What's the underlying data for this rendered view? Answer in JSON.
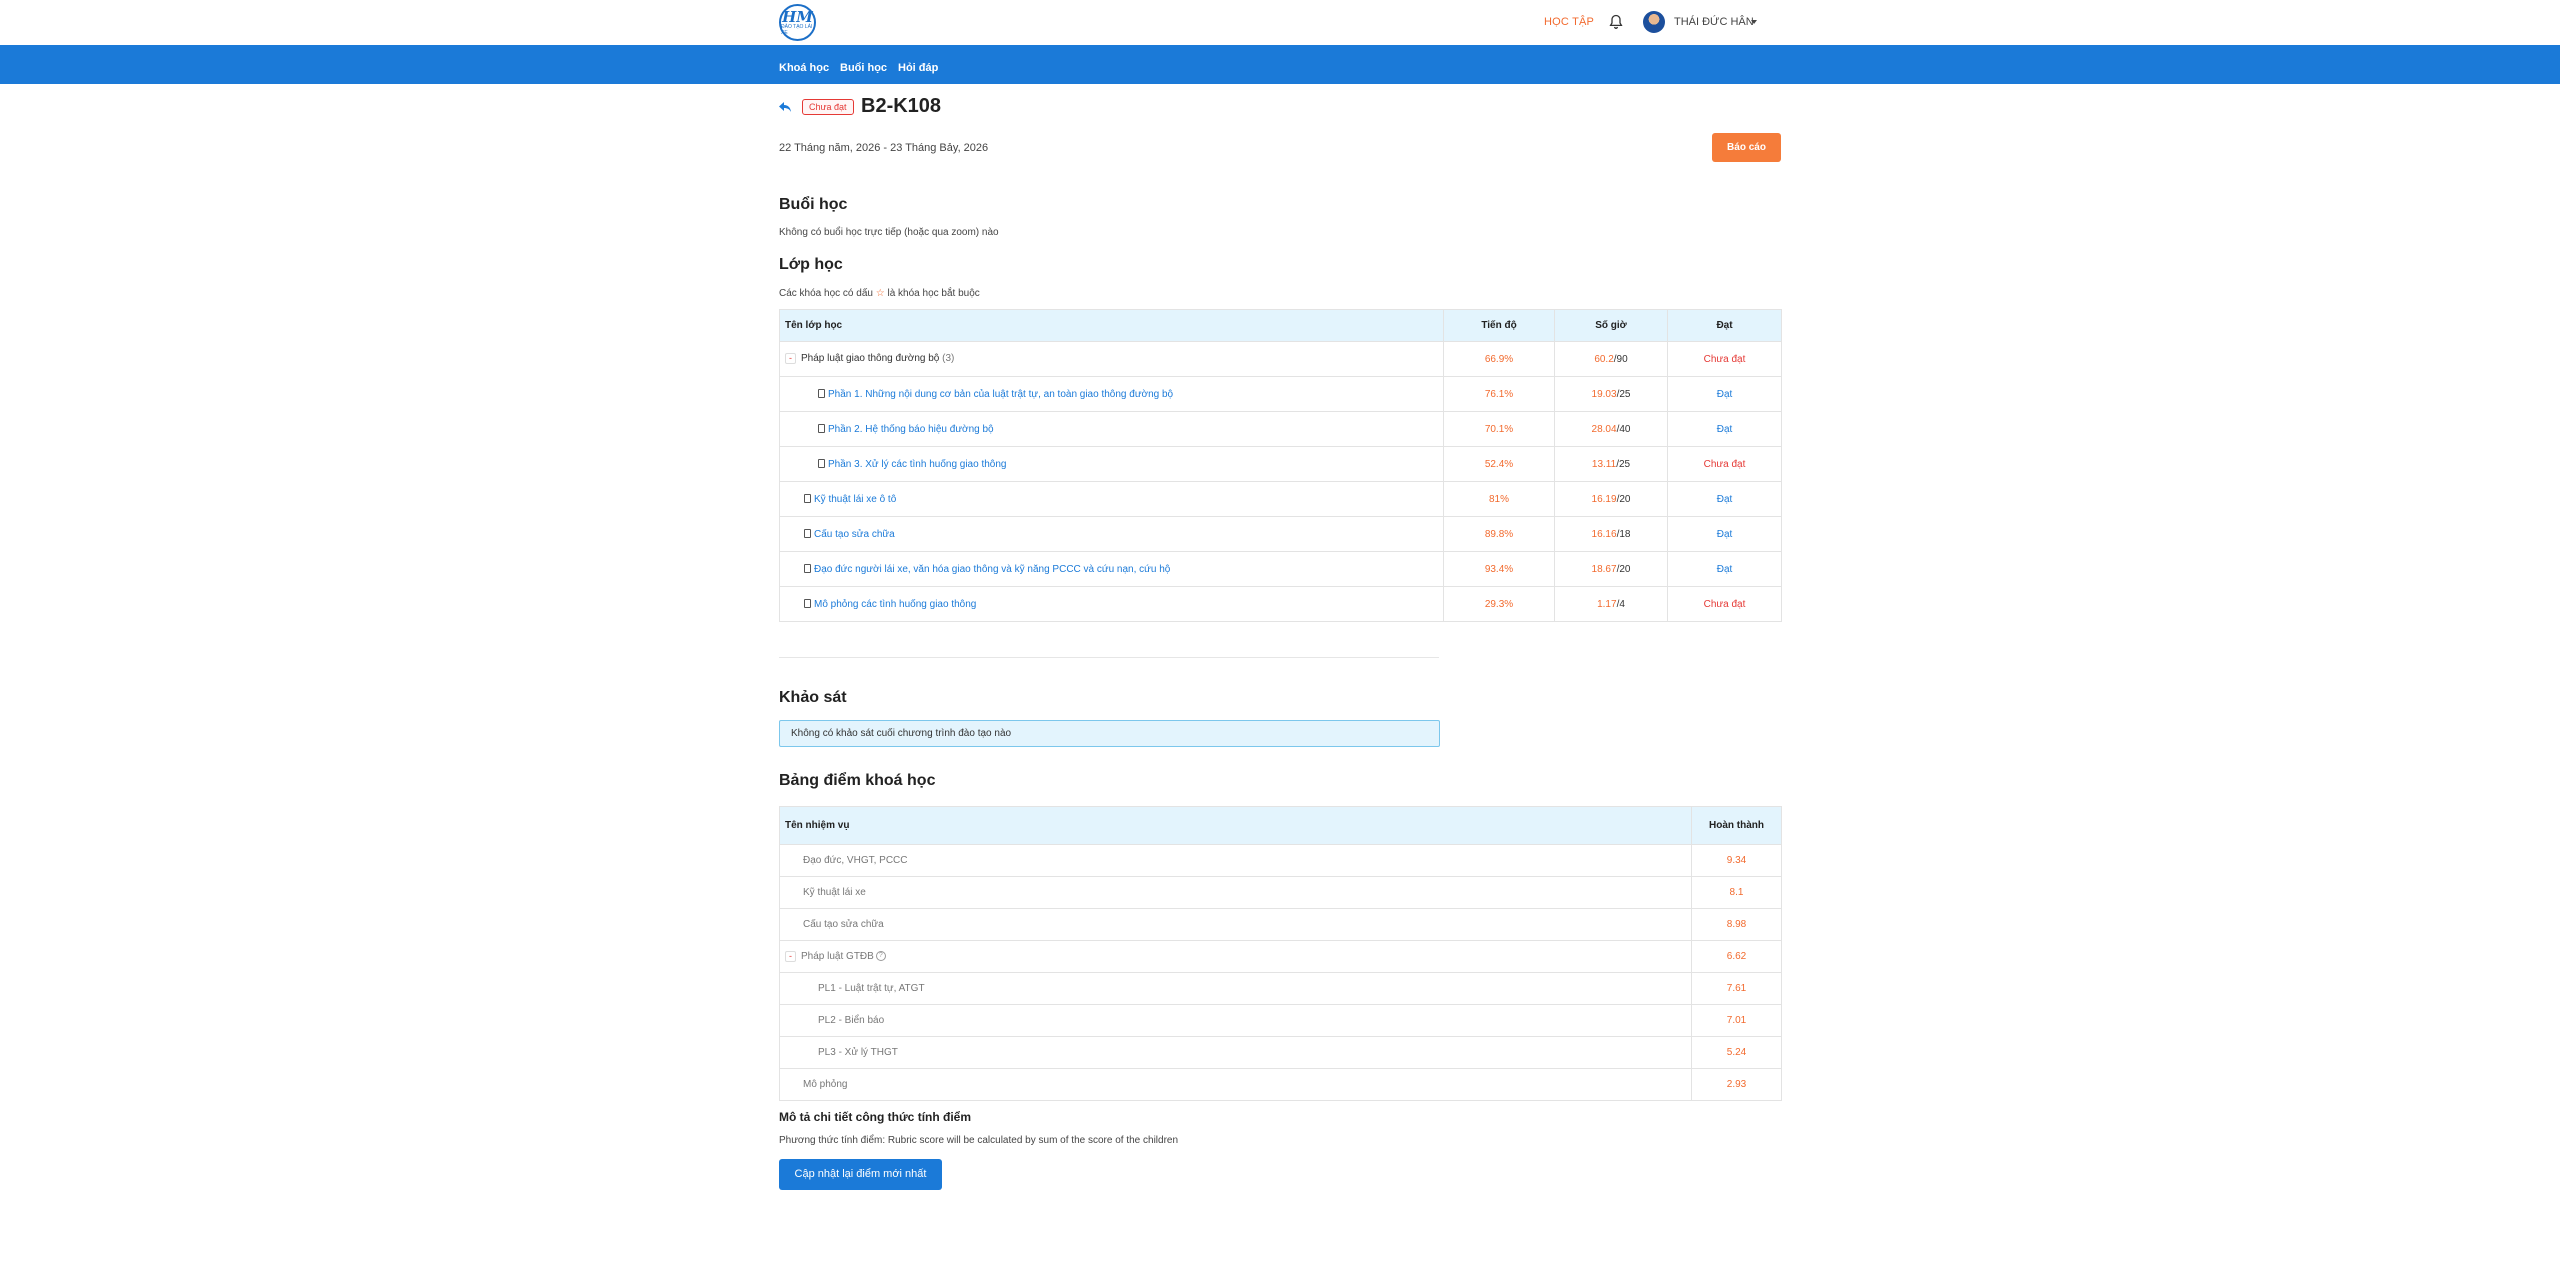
{
  "header": {
    "logo_text": "HM",
    "logo_sub": "ĐÀO TẠO LÁI XE",
    "nav_learning": "HỌC TẬP",
    "username": "THÁI ĐỨC HÂN"
  },
  "navbar": {
    "items": [
      "Khoá học",
      "Buổi học",
      "Hỏi đáp"
    ]
  },
  "course": {
    "status": "Chưa đạt",
    "title": "B2-K108",
    "date_range": "22 Tháng năm, 2026 - 23 Tháng Bảy, 2026",
    "report_button": "Báo cáo"
  },
  "sessions": {
    "heading": "Buổi học",
    "empty_text": "Không có buổi học trực tiếp (hoặc qua zoom) nào"
  },
  "classes": {
    "heading": "Lớp học",
    "note_prefix": "Các khóa học có dấu",
    "note_star": "☆",
    "note_suffix": "là khóa học bắt buộc",
    "columns": [
      "Tên lớp học",
      "Tiến độ",
      "Số giờ",
      "Đạt"
    ],
    "rows": [
      {
        "name": "Pháp luật giao thông đường bộ",
        "count": "(3)",
        "progress": "66.9%",
        "hours_done": "60.2",
        "hours_total": "/90",
        "result": "Chưa đạt"
      },
      {
        "name": "Phần 1. Những nội dung cơ bản của luật trật tự, an toàn giao thông đường bộ",
        "progress": "76.1%",
        "hours_done": "19.03",
        "hours_total": "/25",
        "result": "Đạt"
      },
      {
        "name": "Phần 2. Hệ thống báo hiệu đường bộ",
        "progress": "70.1%",
        "hours_done": "28.04",
        "hours_total": "/40",
        "result": "Đạt"
      },
      {
        "name": "Phần 3. Xử lý các tình huống giao thông",
        "progress": "52.4%",
        "hours_done": "13.11",
        "hours_total": "/25",
        "result": "Chưa đạt"
      },
      {
        "name": "Kỹ thuật lái xe ô tô",
        "progress": "81%",
        "hours_done": "16.19",
        "hours_total": "/20",
        "result": "Đạt"
      },
      {
        "name": "Cấu tạo sửa chữa",
        "progress": "89.8%",
        "hours_done": "16.16",
        "hours_total": "/18",
        "result": "Đạt"
      },
      {
        "name": "Đạo đức người lái xe, văn hóa giao thông và kỹ năng PCCC và cứu nạn, cứu hộ",
        "progress": "93.4%",
        "hours_done": "18.67",
        "hours_total": "/20",
        "result": "Đạt"
      },
      {
        "name": "Mô phỏng các tình huống giao thông",
        "progress": "29.3%",
        "hours_done": "1.17",
        "hours_total": "/4",
        "result": "Chưa đạt"
      }
    ]
  },
  "survey": {
    "heading": "Khảo sát",
    "empty_text": "Không có khảo sát cuối chương trình đào tạo nào"
  },
  "scores": {
    "heading": "Bảng điểm khoá học",
    "columns": [
      "Tên nhiệm vụ",
      "Hoàn thành"
    ],
    "rows": [
      {
        "name": "Đạo đức, VHGT, PCCC",
        "score": "9.34"
      },
      {
        "name": "Kỹ thuật lái xe",
        "score": "8.1"
      },
      {
        "name": "Cấu tạo sửa chữa",
        "score": "8.98"
      },
      {
        "name": "Pháp luật GTĐB",
        "score": "6.62"
      },
      {
        "name": "PL1 - Luật trật tự, ATGT",
        "score": "7.61"
      },
      {
        "name": "PL2 - Biển báo",
        "score": "7.01"
      },
      {
        "name": "PL3 - Xử lý THGT",
        "score": "5.24"
      },
      {
        "name": "Mô phỏng",
        "score": "2.93"
      }
    ]
  },
  "formula": {
    "heading": "Mô tả chi tiết công thức tính điểm",
    "text": "Phương thức tính điểm: Rubric score will be calculated by sum of the score of the children",
    "update_button": "Cập nhật lại điểm mới nhất"
  },
  "colors": {
    "brand_blue": "#1b7ad8",
    "accent_orange": "#f26a2e",
    "fail_red": "#e53935",
    "table_header_bg": "#e3f4fd"
  }
}
